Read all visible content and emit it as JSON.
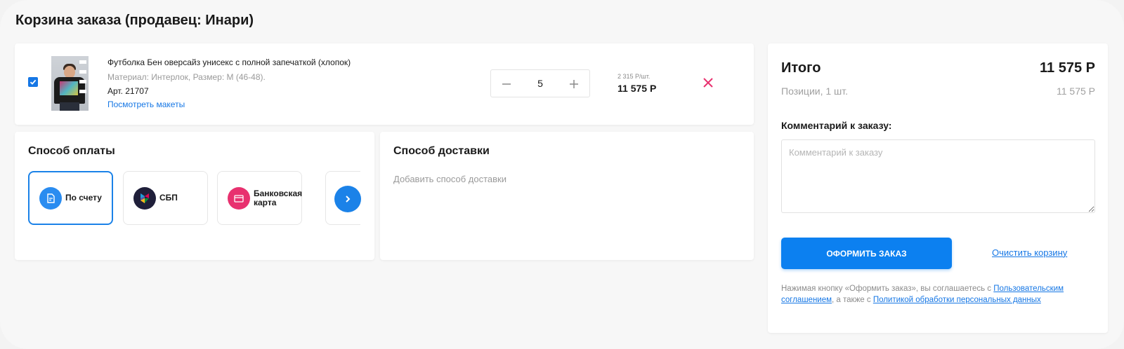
{
  "page": {
    "title": "Корзина заказа (продавец: Инари)"
  },
  "item": {
    "checked": true,
    "name": "Футболка Бен оверсайз унисекс с полной запечаткой (хлопок)",
    "material": "Материал: Интерлок, Размер: М (46-48).",
    "article": "Арт. 21707",
    "mockups_link": "Посмотреть макеты",
    "quantity": "5",
    "unit_price": "2 315 Р/шт.",
    "total_price": "11 575 Р"
  },
  "payment": {
    "title": "Способ оплаты",
    "options": [
      {
        "label_1": "По счету",
        "label_2": "",
        "icon": "document-icon",
        "color": "#2a8cf0",
        "selected": true
      },
      {
        "label_1": "СБП",
        "label_2": "",
        "icon": "sbp-logo-icon",
        "color": "#1f1f3a",
        "selected": false
      },
      {
        "label_1": "Банковская",
        "label_2": "карта",
        "icon": "bank-card-icon",
        "color": "#e8316f",
        "selected": false
      }
    ]
  },
  "delivery": {
    "title": "Способ доставки",
    "add_label": "Добавить способ доставки"
  },
  "summary": {
    "title": "Итого",
    "total": "11 575 Р",
    "positions_label": "Позиции, 1 шт.",
    "positions_value": "11 575 Р",
    "comment_label": "Комментарий к заказу:",
    "comment_placeholder": "Комментарий к заказу",
    "comment_value": "",
    "order_button": "ОФОРМИТЬ ЗАКАЗ",
    "clear_link": "Очистить корзину",
    "agree_text_1": "Нажимая кнопку «Оформить заказ», вы соглашаетесь с ",
    "agree_link_1": "Пользовательским соглашением",
    "agree_text_2": ", а также с ",
    "agree_link_2": "Политикой обработки персональных данных"
  },
  "colors": {
    "accent": "#0c80f0",
    "danger": "#e8316f"
  }
}
